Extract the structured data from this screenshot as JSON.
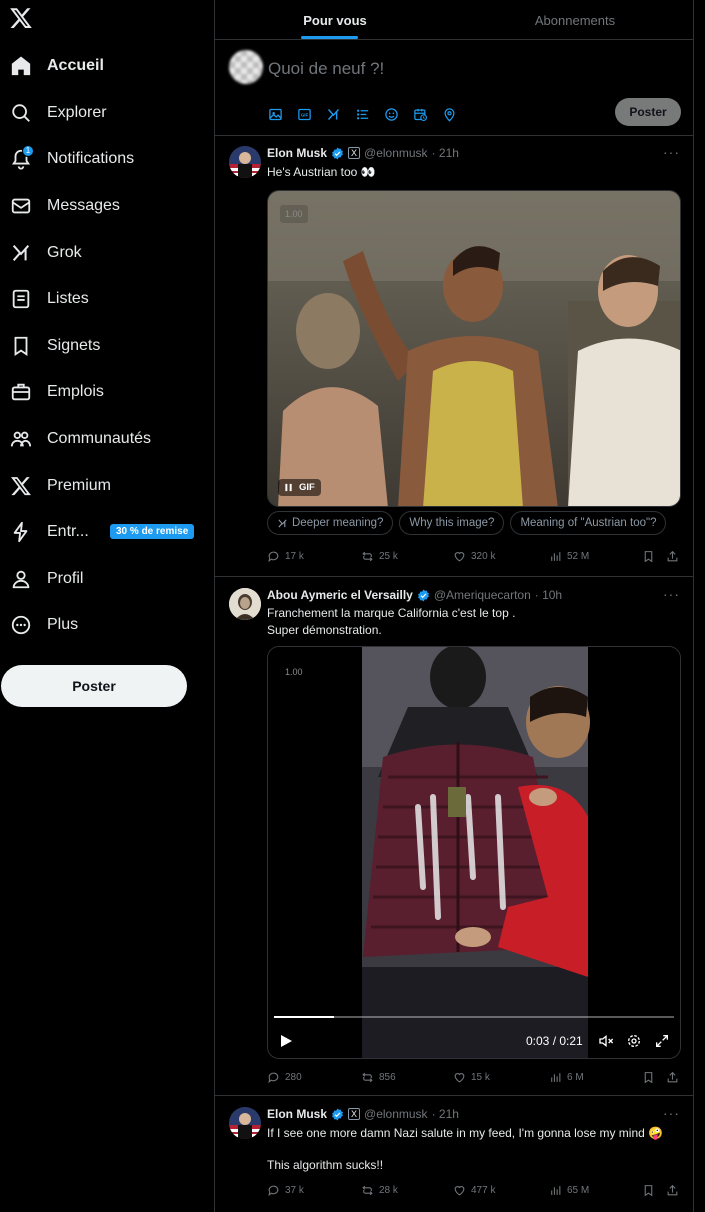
{
  "sidebar": {
    "logo": "x-logo-icon",
    "items": [
      {
        "label": "Accueil",
        "icon": "home-icon",
        "active": true
      },
      {
        "label": "Explorer",
        "icon": "search-icon"
      },
      {
        "label": "Notifications",
        "icon": "bell-icon",
        "badge": "1"
      },
      {
        "label": "Messages",
        "icon": "envelope-icon"
      },
      {
        "label": "Grok",
        "icon": "grok-icon"
      },
      {
        "label": "Listes",
        "icon": "list-icon"
      },
      {
        "label": "Signets",
        "icon": "bookmark-icon"
      },
      {
        "label": "Emplois",
        "icon": "briefcase-icon"
      },
      {
        "label": "Communautés",
        "icon": "people-icon"
      },
      {
        "label": "Premium",
        "icon": "x-logo-icon"
      },
      {
        "label": "Entr...",
        "icon": "lightning-icon",
        "promo": "30 % de remise"
      },
      {
        "label": "Profil",
        "icon": "person-icon"
      },
      {
        "label": "Plus",
        "icon": "more-circle-icon"
      }
    ],
    "post_button": "Poster"
  },
  "tabs": [
    {
      "label": "Pour vous",
      "active": true
    },
    {
      "label": "Abonnements",
      "active": false
    }
  ],
  "composer": {
    "placeholder": "Quoi de neuf ?!",
    "post_button": "Poster",
    "tools": [
      "image-icon",
      "gif-icon",
      "grok-icon",
      "poll-icon",
      "emoji-icon",
      "schedule-icon",
      "location-icon"
    ]
  },
  "tweets": [
    {
      "name": "Elon Musk",
      "handle": "@elonmusk",
      "time": "· 21h",
      "verified": true,
      "affiliate": "X",
      "text": "He's Austrian too 👀",
      "media": {
        "type": "gif",
        "rate": "1.00",
        "gif_label": "GIF"
      },
      "chips": [
        "Deeper meaning?",
        "Why this image?",
        "Meaning of \"Austrian too\"?"
      ],
      "stats": {
        "replies": "17 k",
        "reposts": "25 k",
        "likes": "320 k",
        "views": "52 M"
      }
    },
    {
      "name": "Abou Aymeric el Versailly",
      "handle": "@Ameriquecarton",
      "time": "· 10h",
      "verified": true,
      "text_lines": [
        "Franchement la marque California c'est le top .",
        "Super démonstration."
      ],
      "media": {
        "type": "video",
        "rate": "1.00",
        "time": "0:03 / 0:21",
        "progress": 0.15
      },
      "stats": {
        "replies": "280",
        "reposts": "856",
        "likes": "15 k",
        "views": "6 M"
      }
    },
    {
      "name": "Elon Musk",
      "handle": "@elonmusk",
      "time": "· 21h",
      "verified": true,
      "affiliate": "X",
      "text_lines": [
        "If I see one more damn Nazi salute in my feed, I'm gonna lose my mind 🤪",
        "",
        "This algorithm sucks!!"
      ],
      "stats": {
        "replies": "37 k",
        "reposts": "28 k",
        "likes": "477 k",
        "views": "65 M"
      }
    }
  ],
  "colors": {
    "accent": "#1d9bf0",
    "bg": "#000000",
    "border": "#2f3336",
    "muted": "#71767b"
  }
}
